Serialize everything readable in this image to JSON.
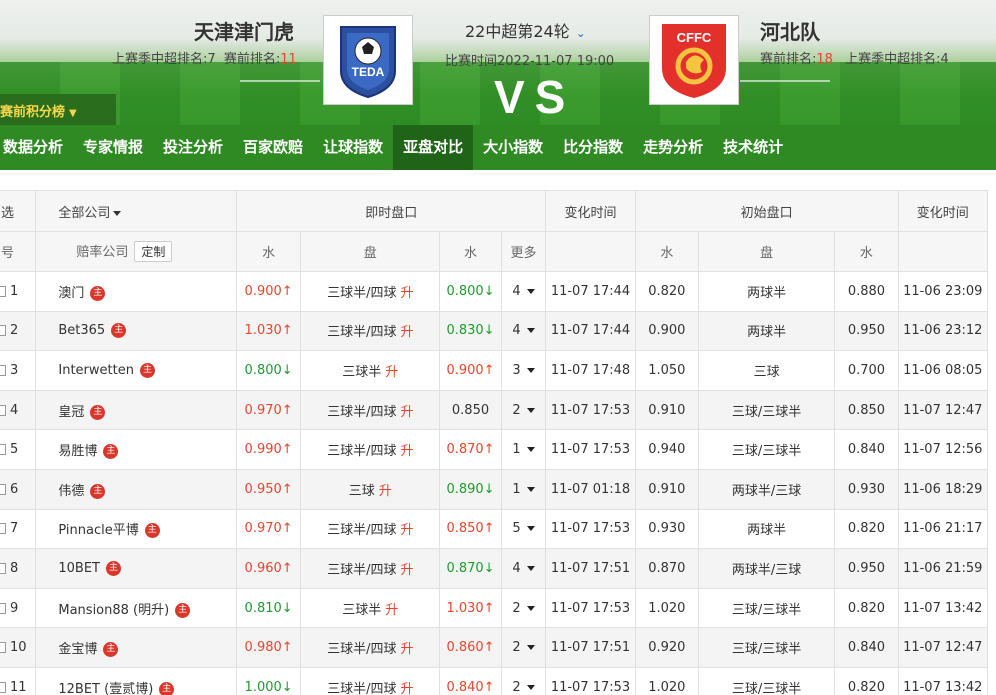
{
  "home": {
    "name": "天津津门虎",
    "last_season_label": "上赛季中超排名:",
    "last_season_rank": "7",
    "pre_label": "赛前排名:",
    "pre_rank": "11"
  },
  "away": {
    "name": "河北队",
    "last_season_label": "上赛季中超排名:",
    "last_season_rank": "4",
    "pre_label": "赛前排名:",
    "pre_rank": "18"
  },
  "match": {
    "round": "22中超第24轮",
    "time_label": "比赛时间",
    "time": "2022-11-07 19:00",
    "vs": "VS"
  },
  "home_logo_text": "TEDA",
  "away_logo_text": "CFFC",
  "standings_button": "赛前积分榜",
  "nav": [
    "数据分析",
    "专家情报",
    "投注分析",
    "百家欧赔",
    "让球指数",
    "亚盘对比",
    "大小指数",
    "比分指数",
    "走势分析",
    "技术统计"
  ],
  "nav_active": 5,
  "table": {
    "header1": {
      "select": "选",
      "all_companies": "全部公司",
      "live": "即时盘口",
      "change_time": "变化时间",
      "initial": "初始盘口",
      "change_time2": "变化时间"
    },
    "header2": {
      "no": "号",
      "company": "赔率公司",
      "custom": "定制",
      "water1": "水",
      "line": "盘",
      "water2": "水",
      "more": "更多",
      "init_water1": "水",
      "init_line": "盘",
      "init_water2": "水"
    },
    "rows": [
      {
        "no": "1",
        "company": "澳门",
        "w1": "0.900",
        "w1_dir": "up",
        "line": "三球半/四球",
        "w2": "0.800",
        "w2_dir": "down",
        "more": "4",
        "time": "11-07 17:44",
        "iw1": "0.820",
        "iline": "两球半",
        "iw2": "0.880",
        "itime": "11-06 23:09"
      },
      {
        "no": "2",
        "company": "Bet365",
        "w1": "1.030",
        "w1_dir": "up",
        "line": "三球半/四球",
        "w2": "0.830",
        "w2_dir": "down",
        "more": "4",
        "time": "11-07 17:44",
        "iw1": "0.900",
        "iline": "两球半",
        "iw2": "0.950",
        "itime": "11-06 23:12"
      },
      {
        "no": "3",
        "company": "Interwetten",
        "w1": "0.800",
        "w1_dir": "down",
        "line": "三球半",
        "w2": "0.900",
        "w2_dir": "up",
        "more": "3",
        "time": "11-07 17:48",
        "iw1": "1.050",
        "iline": "三球",
        "iw2": "0.700",
        "itime": "11-06 08:05"
      },
      {
        "no": "4",
        "company": "皇冠",
        "w1": "0.970",
        "w1_dir": "up",
        "line": "三球半/四球",
        "w2": "0.850",
        "w2_dir": "none",
        "more": "2",
        "time": "11-07 17:53",
        "iw1": "0.910",
        "iline": "三球/三球半",
        "iw2": "0.850",
        "itime": "11-07 12:47"
      },
      {
        "no": "5",
        "company": "易胜博",
        "w1": "0.990",
        "w1_dir": "up",
        "line": "三球半/四球",
        "w2": "0.870",
        "w2_dir": "up",
        "more": "1",
        "time": "11-07 17:53",
        "iw1": "0.940",
        "iline": "三球/三球半",
        "iw2": "0.840",
        "itime": "11-07 12:56"
      },
      {
        "no": "6",
        "company": "伟德",
        "w1": "0.950",
        "w1_dir": "up",
        "line": "三球",
        "w2": "0.890",
        "w2_dir": "down",
        "more": "1",
        "time": "11-07 01:18",
        "iw1": "0.910",
        "iline": "两球半/三球",
        "iw2": "0.930",
        "itime": "11-06 18:29"
      },
      {
        "no": "7",
        "company": "Pinnacle平博",
        "w1": "0.970",
        "w1_dir": "up",
        "line": "三球半/四球",
        "w2": "0.850",
        "w2_dir": "up",
        "more": "5",
        "time": "11-07 17:53",
        "iw1": "0.930",
        "iline": "两球半",
        "iw2": "0.820",
        "itime": "11-06 21:17"
      },
      {
        "no": "8",
        "company": "10BET",
        "w1": "0.960",
        "w1_dir": "up",
        "line": "三球半/四球",
        "w2": "0.870",
        "w2_dir": "down",
        "more": "4",
        "time": "11-07 17:51",
        "iw1": "0.870",
        "iline": "两球半/三球",
        "iw2": "0.950",
        "itime": "11-06 21:59"
      },
      {
        "no": "9",
        "company": "Mansion88 (明升)",
        "w1": "0.810",
        "w1_dir": "down",
        "line": "三球半",
        "w2": "1.030",
        "w2_dir": "up",
        "more": "2",
        "time": "11-07 17:53",
        "iw1": "1.020",
        "iline": "三球/三球半",
        "iw2": "0.820",
        "itime": "11-07 13:42"
      },
      {
        "no": "10",
        "company": "金宝博",
        "w1": "0.980",
        "w1_dir": "up",
        "line": "三球半/四球",
        "w2": "0.860",
        "w2_dir": "up",
        "more": "2",
        "time": "11-07 17:51",
        "iw1": "0.920",
        "iline": "三球/三球半",
        "iw2": "0.840",
        "itime": "11-07 12:47"
      },
      {
        "no": "11",
        "company": "12BET (壹贰博)",
        "w1": "1.000",
        "w1_dir": "down",
        "line": "三球半/四球",
        "w2": "0.840",
        "w2_dir": "up",
        "more": "2",
        "time": "11-07 17:53",
        "iw1": "1.020",
        "iline": "三球/三球半",
        "iw2": "0.820",
        "itime": "11-07 13:42"
      }
    ],
    "zhu_label": "主",
    "sheng_label": "升",
    "arrow_up": "↑",
    "arrow_down": "↓"
  },
  "colors": {
    "nav_bg": "#2f8a24",
    "nav_active": "#1f6417",
    "up": "#e8452c",
    "down": "#1f9a2f",
    "standings_text": "#f6d74a"
  }
}
